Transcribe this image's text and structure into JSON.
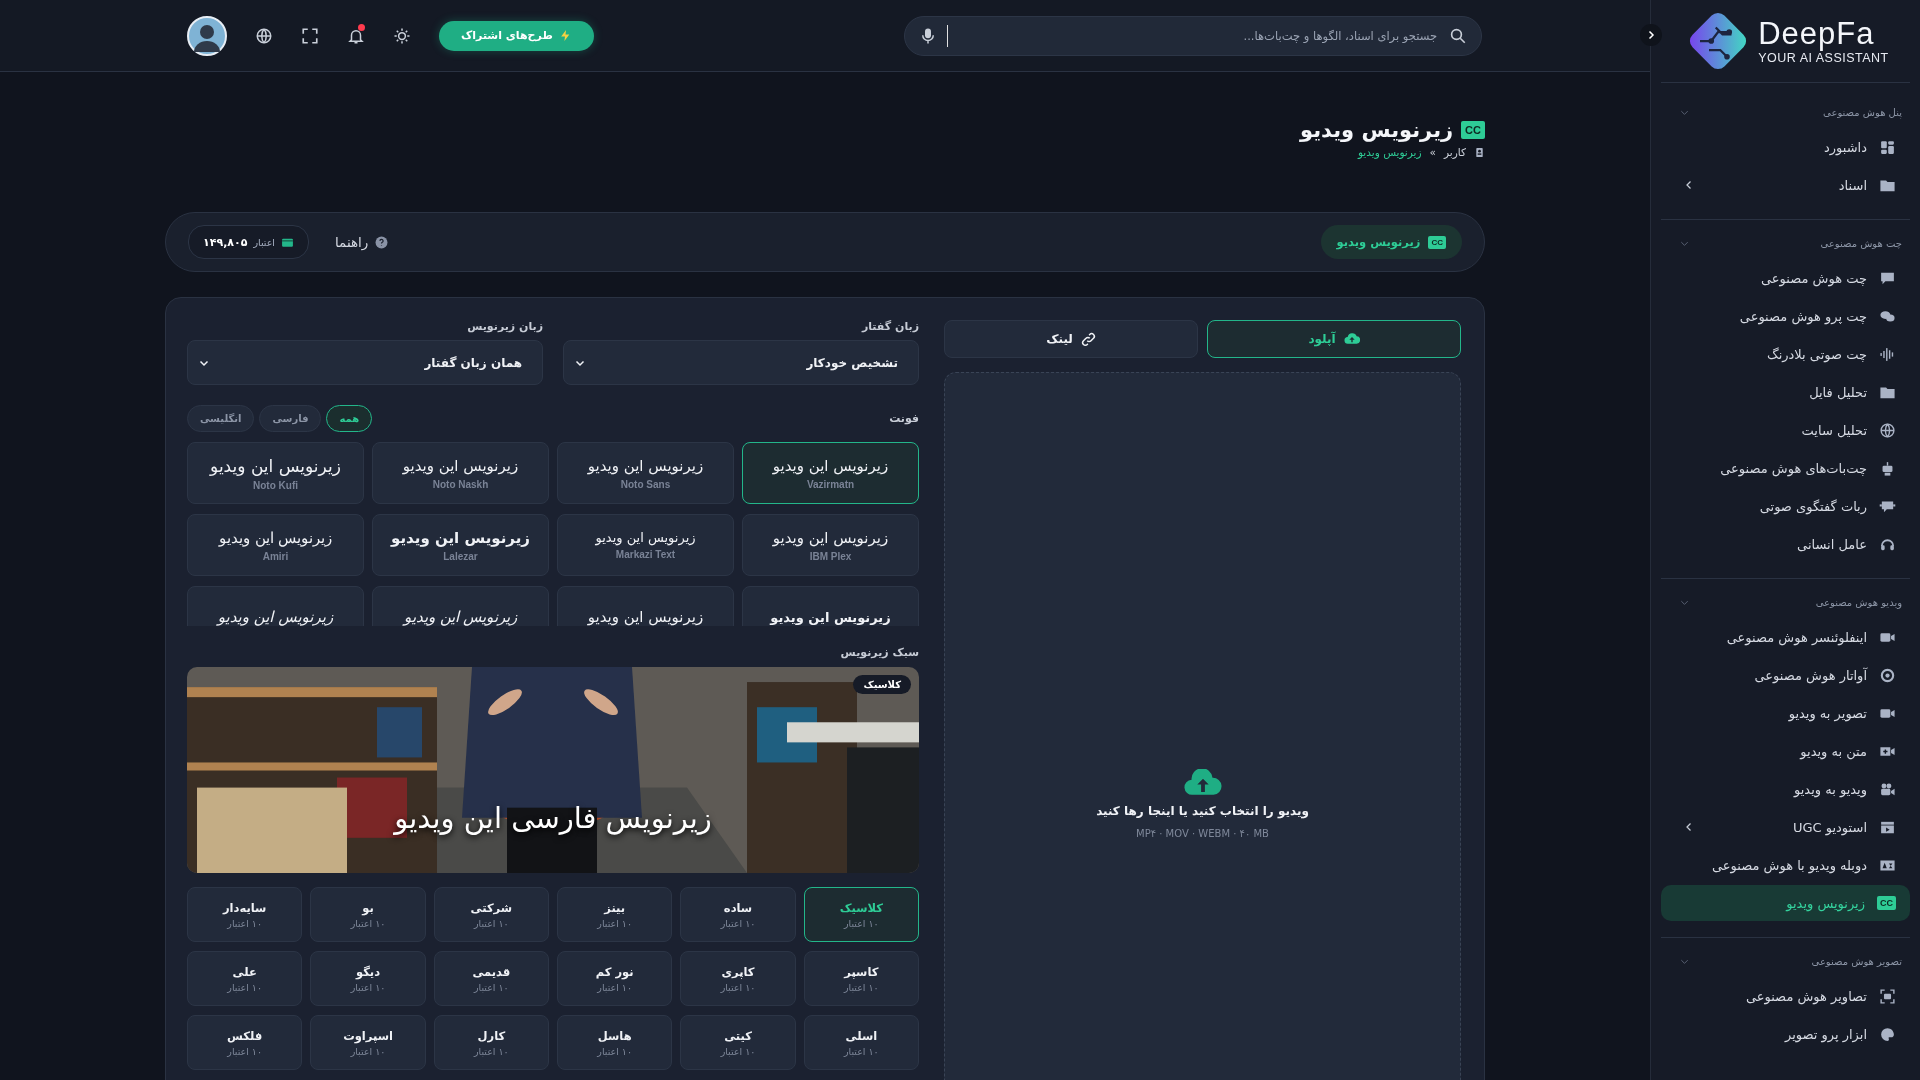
{
  "sidebar": {
    "logo": {
      "name": "DeepFa",
      "tagline": "YOUR AI ASSISTANT"
    },
    "sections": [
      {
        "title": "پنل هوش مصنوعی",
        "expanded": true,
        "items": [
          {
            "label": "داشبورد",
            "selected": false,
            "expandable": false
          },
          {
            "label": "اسناد",
            "selected": false,
            "expandable": true
          }
        ]
      },
      {
        "title": "چت هوش مصنوعی",
        "expanded": true,
        "items": [
          {
            "label": "چت هوش مصنوعی",
            "selected": false,
            "expandable": false
          },
          {
            "label": "چت پرو هوش مصنوعی",
            "selected": false,
            "expandable": false
          },
          {
            "label": "چت صوتی بلادرنگ",
            "selected": false,
            "expandable": false
          },
          {
            "label": "تحلیل فایل",
            "selected": false,
            "expandable": false
          },
          {
            "label": "تحلیل سایت",
            "selected": false,
            "expandable": false
          },
          {
            "label": "چت‌بات‌های هوش مصنوعی",
            "selected": false,
            "expandable": false
          },
          {
            "label": "ربات گفتگوی صوتی",
            "selected": false,
            "expandable": false
          },
          {
            "label": "عامل انسانی",
            "selected": false,
            "expandable": false
          }
        ]
      },
      {
        "title": "ویدیو هوش مصنوعی",
        "expanded": true,
        "items": [
          {
            "label": "اینفلوئنسر هوش مصنوعی",
            "selected": false,
            "expandable": false
          },
          {
            "label": "آواتار هوش مصنوعی",
            "selected": false,
            "expandable": false
          },
          {
            "label": "تصویر به ویدیو",
            "selected": false,
            "expandable": false
          },
          {
            "label": "متن به ویدیو",
            "selected": false,
            "expandable": false
          },
          {
            "label": "ویدیو به ویدیو",
            "selected": false,
            "expandable": false
          },
          {
            "label": "استودیو UGC",
            "selected": false,
            "expandable": true
          },
          {
            "label": "دوبله ویدیو با هوش مصنوعی",
            "selected": false,
            "expandable": false
          },
          {
            "label": "زیرنویس ویدیو",
            "selected": true,
            "expandable": false,
            "badge": "CC"
          }
        ]
      },
      {
        "title": "تصویر هوش مصنوعی",
        "expanded": true,
        "items": [
          {
            "label": "تصاویر هوش مصنوعی",
            "selected": false,
            "expandable": false
          },
          {
            "label": "ابزار پرو تصویر",
            "selected": false,
            "expandable": false
          }
        ]
      }
    ]
  },
  "header": {
    "search": {
      "placeholder": "جستجو برای اسناد، الگوها و چت‌بات‌ها..."
    },
    "subscribe_button": "طرح‌های اشتراک",
    "notifications": {
      "unread": true
    }
  },
  "page": {
    "title": "زیرنویس ویدیو",
    "badge": "CC",
    "breadcrumb": {
      "items": [
        "کاربر",
        "زیرنویس ویدیو"
      ],
      "separator": "»"
    }
  },
  "toolbar": {
    "tool_chip": {
      "label": "زیرنویس ویدیو",
      "badge": "CC"
    },
    "help": "راهنما",
    "credit": {
      "label": "اعتبار",
      "value": "۱۴۹,۸۰۵"
    }
  },
  "source_tabs": [
    {
      "label": "آپلود",
      "selected": true
    },
    {
      "label": "لینک",
      "selected": false
    }
  ],
  "dropzone": {
    "title": "ویدیو را انتخاب کنید یا اینجا رها کنید",
    "formats": "MP۴ · MOV · WEBM · ۴۰ MB"
  },
  "settings": {
    "speech_language": {
      "label": "زبان گفتار",
      "value": "تشخیص خودکار"
    },
    "subtitle_language": {
      "label": "زبان زیرنویس",
      "value": "همان زبان گفتار"
    },
    "font_label": "فونت",
    "font_filters": [
      {
        "label": "همه",
        "selected": true
      },
      {
        "label": "فارسی",
        "selected": false
      },
      {
        "label": "انگلیسی",
        "selected": false
      }
    ],
    "fonts": [
      {
        "sample": "زیرنویس این ویدیو",
        "name": "Vazirmatn",
        "selected": true
      },
      {
        "sample": "زیرنویس این ویدیو",
        "name": "Noto Sans",
        "selected": false
      },
      {
        "sample": "زیرنویس این ویدیو",
        "name": "Noto Naskh",
        "selected": false
      },
      {
        "sample": "زیرنویس این ویدیو",
        "name": "Noto Kufi",
        "selected": false
      },
      {
        "sample": "زیرنویس این ویدیو",
        "name": "IBM Plex",
        "selected": false
      },
      {
        "sample": "زیرنویس این ویدیو",
        "name": "Markazi Text",
        "selected": false
      },
      {
        "sample": "زیرنویس این ویدیو",
        "name": "Lalezar",
        "selected": false
      },
      {
        "sample": "زیرنویس این ویدیو",
        "name": "Amiri",
        "selected": false
      },
      {
        "sample": "زیرنویس این ویدیو",
        "selected": false
      },
      {
        "sample": "زیرنویس این ویدیو",
        "selected": false
      },
      {
        "sample": "زیرنویس این ویدیو",
        "selected": false
      },
      {
        "sample": "زیرنویس این ویدیو",
        "selected": false
      }
    ],
    "style_label": "سبک زیرنویس",
    "preview": {
      "kind": "picture",
      "caption": "زیرنویس فارسی این ویدیو",
      "badge": "کلاسیک"
    },
    "styles": [
      {
        "name": "کلاسیک",
        "credit": "۱۰ اعتبار",
        "selected": true
      },
      {
        "name": "ساده",
        "credit": "۱۰ اعتبار",
        "selected": false
      },
      {
        "name": "بینز",
        "credit": "۱۰ اعتبار",
        "selected": false
      },
      {
        "name": "شرکتی",
        "credit": "۱۰ اعتبار",
        "selected": false
      },
      {
        "name": "بو",
        "credit": "۱۰ اعتبار",
        "selected": false
      },
      {
        "name": "سایه‌دار",
        "credit": "۱۰ اعتبار",
        "selected": false
      },
      {
        "name": "کاسپر",
        "credit": "۱۰ اعتبار",
        "selected": false
      },
      {
        "name": "کاپری",
        "credit": "۱۰ اعتبار",
        "selected": false
      },
      {
        "name": "نور کم",
        "credit": "۱۰ اعتبار",
        "selected": false
      },
      {
        "name": "قدیمی",
        "credit": "۱۰ اعتبار",
        "selected": false
      },
      {
        "name": "دیگو",
        "credit": "۱۰ اعتبار",
        "selected": false
      },
      {
        "name": "علی",
        "credit": "۱۰ اعتبار",
        "selected": false
      },
      {
        "name": "اسلی",
        "credit": "۱۰ اعتبار",
        "selected": false
      },
      {
        "name": "کیتی",
        "credit": "۱۰ اعتبار",
        "selected": false
      },
      {
        "name": "هاسل",
        "credit": "۱۰ اعتبار",
        "selected": false
      },
      {
        "name": "کارل",
        "credit": "۱۰ اعتبار",
        "selected": false
      },
      {
        "name": "اسپراوت",
        "credit": "۱۰ اعتبار",
        "selected": false
      },
      {
        "name": "فلکس",
        "credit": "۱۰ اعتبار",
        "selected": false
      }
    ]
  }
}
